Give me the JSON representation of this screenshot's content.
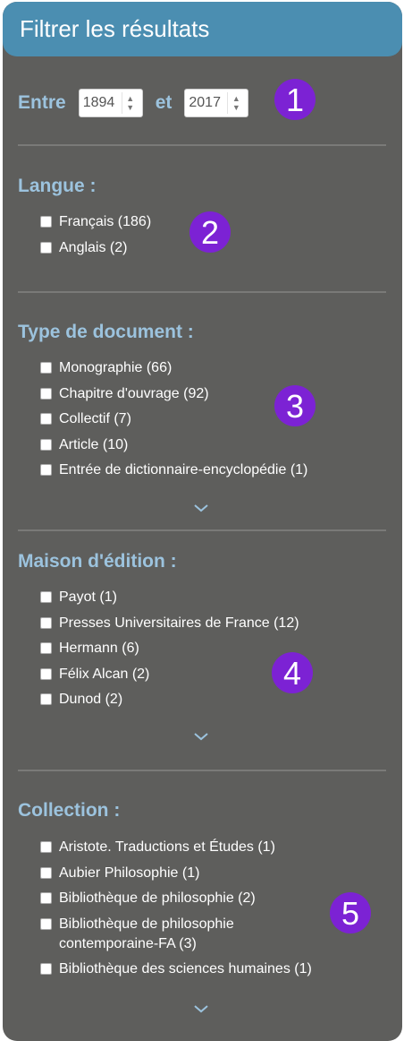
{
  "header": {
    "title": "Filtrer les résultats"
  },
  "date_range": {
    "from_label": "Entre",
    "from_value": "1894",
    "to_label": "et",
    "to_value": "2017"
  },
  "badges": [
    "1",
    "2",
    "3",
    "4",
    "5"
  ],
  "sections": {
    "langue": {
      "title": "Langue :",
      "options": [
        "Français (186)",
        "Anglais (2)"
      ]
    },
    "type": {
      "title": "Type de document :",
      "options": [
        "Monographie (66)",
        "Chapitre d'ouvrage (92)",
        "Collectif (7)",
        "Article (10)",
        "Entrée de dictionnaire-encyclopédie (1)"
      ]
    },
    "maison": {
      "title": "Maison d'édition :",
      "options": [
        "Payot (1)",
        "Presses Universitaires de France (12)",
        "Hermann (6)",
        "Félix Alcan (2)",
        "Dunod (2)"
      ]
    },
    "collection": {
      "title": "Collection :",
      "options": [
        "Aristote. Traductions et Études (1)",
        "Aubier Philosophie (1)",
        "Bibliothèque de philosophie (2)",
        "Bibliothèque de philosophie contemporaine-FA (3)",
        "Bibliothèque des sciences humaines (1)"
      ]
    }
  },
  "colors": {
    "panel": "#5e5e5c",
    "header": "#4b8eb1",
    "title": "#9cc3de",
    "badge": "#7c22d4"
  },
  "icons": {
    "expand": "chevron-down-icon",
    "spinner": "spinner-arrows-icon"
  }
}
